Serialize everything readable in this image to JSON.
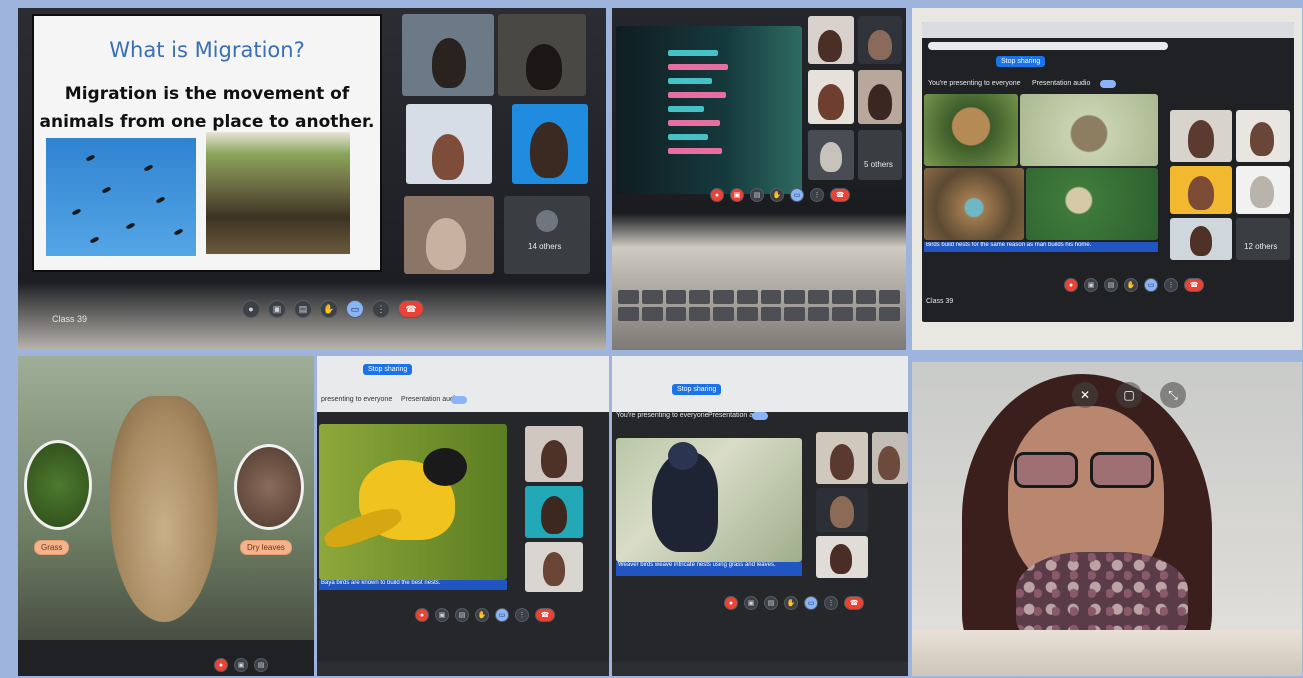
{
  "collage": {
    "photo1": {
      "slide_title": "What is Migration?",
      "slide_body": "Migration is the movement of animals from one place to another.",
      "meeting_name": "Class 39",
      "others_count": "14 others"
    },
    "photo2": {
      "others_count": "5 others"
    },
    "photo3": {
      "stop_sharing": "Stop sharing",
      "presenting_text": "You're presenting to everyone",
      "presentation_audio": "Presentation audio",
      "caption": "Birds build nests for the same reason as man builds his home.",
      "meeting_name": "Class 39",
      "others_count": "12 others"
    },
    "photo4": {
      "label_left": "Grass",
      "label_right": "Dry leaves"
    },
    "photo5": {
      "stop_sharing": "Stop sharing",
      "presenting_text": "presenting to everyone",
      "presentation_audio": "Presentation audio",
      "caption": "Baya birds are known to build the best nests."
    },
    "photo6": {
      "stop_sharing": "Stop sharing",
      "presenting_text": "You're presenting to everyone",
      "presentation_audio": "Presentation audio",
      "caption": "Weaver birds weave intricate nests using grass and leaves."
    }
  },
  "colors": {
    "background": "#9fb4dd",
    "meet_red": "#ea4335",
    "meet_blue": "#8ab4f8",
    "caption_blue": "#2156c2"
  }
}
